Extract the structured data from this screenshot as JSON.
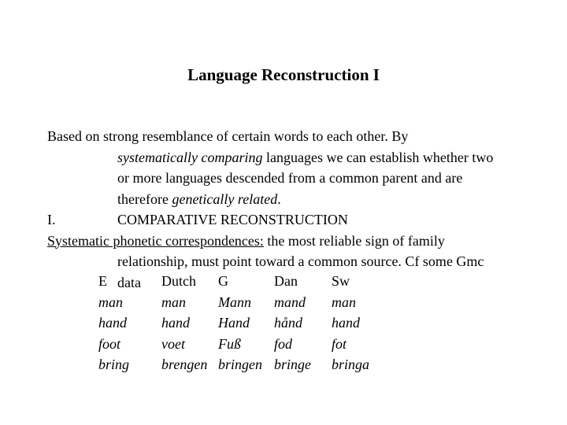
{
  "title": "Language Reconstruction I",
  "intro": {
    "line1": "Based on strong resemblance of certain words to each other. By",
    "line2_italic": "systematically comparing",
    "line2_rest": " languages we can establish whether two",
    "line3": "or more languages descended from a common parent and are",
    "line4_start": "therefore ",
    "line4_italic": "genetically related",
    "line4_end": "."
  },
  "section": {
    "numeral": "I.",
    "heading": "COMPARATIVE RECONSTRUCTION"
  },
  "correspondences": {
    "term": "Systematic phonetic correspondences:",
    "line1_rest": " the most reliable sign of  family",
    "line2": "relationship, must point toward a common source. Cf some Gmc",
    "line3": "data"
  },
  "table": {
    "headers": [
      "E",
      "Dutch",
      "G",
      "Dan",
      "Sw"
    ],
    "rows": [
      [
        "man",
        "man",
        "Mann",
        "mand",
        "man"
      ],
      [
        "hand",
        "hand",
        "Hand",
        "hånd",
        "hand"
      ],
      [
        "foot",
        "voet",
        "Fuß",
        "fod",
        "fot"
      ],
      [
        "bring",
        "brengen",
        "bringen",
        "bringe",
        "bringa"
      ]
    ]
  }
}
